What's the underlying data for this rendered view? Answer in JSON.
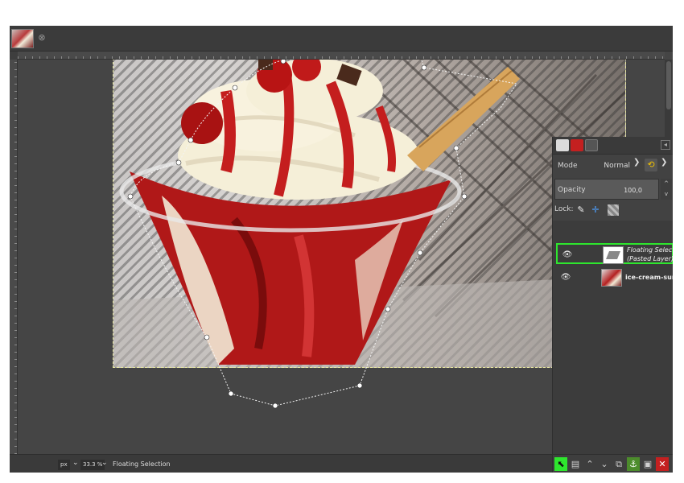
{
  "tabs": [
    {
      "name": "ice-cream image tab"
    }
  ],
  "dock": {
    "mode_label": "Mode",
    "mode_value": "Normal",
    "opacity_label": "Opacity",
    "opacity_value": "100,0",
    "lock_label": "Lock:"
  },
  "layers": [
    {
      "name": "Floating Selection",
      "sub": "(Pasted Layer)",
      "visible": true,
      "selected": true
    },
    {
      "name": "ice-cream-sundae",
      "sub": "",
      "visible": true,
      "selected": false
    }
  ],
  "status": {
    "unit": "px",
    "zoom": "33.3 %",
    "message": "Floating Selection"
  },
  "colors": {
    "highlight": "#2ee62e",
    "panel": "#424242",
    "canvas_bg": "#454545"
  },
  "icons": {
    "eye": "eye-icon",
    "new_layer": "new-layer-icon",
    "anchor": "anchor-icon",
    "delete": "delete-icon"
  }
}
